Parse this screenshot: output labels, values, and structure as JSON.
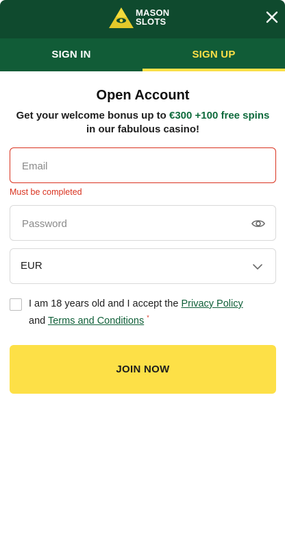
{
  "header": {
    "brand_line1": "MASON",
    "brand_line2": "SLOTS",
    "close_icon": "close-icon"
  },
  "tabs": [
    {
      "label": "SIGN IN",
      "active": false
    },
    {
      "label": "SIGN UP",
      "active": true
    }
  ],
  "form": {
    "title": "Open Account",
    "subtitle_prefix": "Get your welcome bonus up to ",
    "subtitle_bonus": "€300 +100 free spins",
    "subtitle_suffix": "in our fabulous casino!",
    "email_placeholder": "Email",
    "email_value": "",
    "email_error": "Must be completed",
    "password_placeholder": "Password",
    "password_value": "",
    "currency_value": "EUR",
    "terms_prefix": "I am 18 years old and I accept the ",
    "privacy_link": "Privacy Policy",
    "terms_and": "and ",
    "terms_link": "Terms and Conditions",
    "required_mark": "*",
    "checkbox_checked": false,
    "submit_label": "JOIN NOW"
  },
  "colors": {
    "header_bg": "#0f4a2e",
    "tabs_bg": "#115c37",
    "accent_yellow": "#fde047",
    "error_red": "#d9321f",
    "link_green": "#0f5f38"
  }
}
